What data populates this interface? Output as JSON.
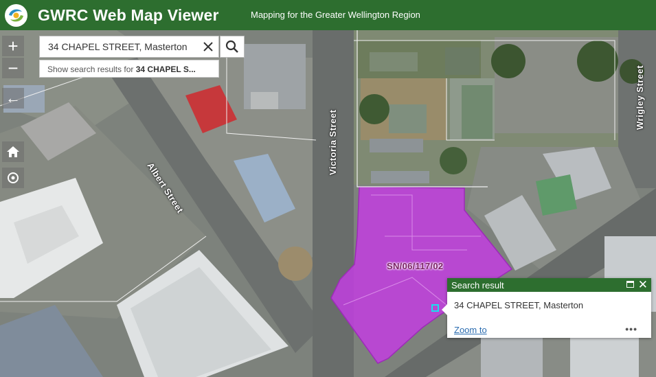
{
  "header": {
    "title": "GWRC Web Map Viewer",
    "subtitle": "Mapping for the Greater Wellington Region"
  },
  "search": {
    "value": "34 CHAPEL STREET, Masterton",
    "suggestion_prefix": "Show search results for ",
    "suggestion_term": "34 CHAPEL S..."
  },
  "map": {
    "street_labels": [
      "Albert Street",
      "Victoria Street",
      "Wrigley Street"
    ],
    "parcel_label": "SN/06/117/02"
  },
  "popup": {
    "title": "Search result",
    "address": "34 CHAPEL STREET, Masterton",
    "zoom_link": "Zoom to"
  },
  "colors": {
    "header_green": "#2d6e2f",
    "parcel_magenta": "#c23ee0",
    "link_blue": "#2b6cb0"
  }
}
